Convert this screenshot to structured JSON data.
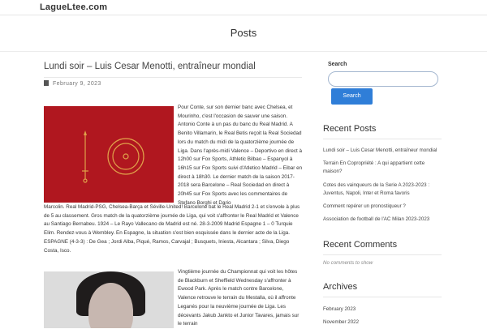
{
  "site": {
    "title": "LagueLtee.com"
  },
  "page": {
    "heading": "Posts"
  },
  "post1": {
    "title": "Lundi soir – Luis Cesar Menotti, entraîneur mondial",
    "date": "February 9, 2023",
    "text_wrap": "Pour Conte, sur son dernier banc avec Chelsea, et Mourinho, c'est l'occasion de sauver une saison. Antonio Conte à un pas du banc du Real Madrid. A Benito Villamarin, le Real Betis reçoit la Real Sociedad lors du match du midi de la quatorzième journée de Liga. Dans l'après-midi Valence – Deportivo en direct à 12h00 sur Fox Sports, Athletic Bilbao – Espanyol à 16h15 sur Fox Sports suivi d'Atletico Madrid – Eibar en direct à 18h30. Le dernier match de la saison 2017-2018 sera Barcelone – Real Sociedad en direct à 20h45 sur Fox Sports avec les commentaires de Stefano Borghi et Dario",
    "text_full": "Marcolin. Real Madrid-PSG, Chelsea-Barça et Séville-United! Barcelone bat le Real Madrid 2-1 et s'envole à plus de 5 au classement. Gros match de la quatorzième journée de Liga, qui voit s'affronter le Real Madrid et Valence au Santiago Bernabeu. 1924 – Le Rayo Vallecano de Madrid est né. 28-3-2009 Madrid Espagne 1 – 0 Turquie Elim. Rendez-vous à Wembley. En Espagne, la situation s'est bien esquissée dans le dernier acte de la Liga. ESPAGNE (4-3-3) : De Gea ; Jordi Alba, Piqué, Ramos, Carvajal ; Busquets, Iniesta, Alcantara ; Silva, Diego Costa, Isco."
  },
  "post2": {
    "text_wrap": "Vingtième journée du Championnat qui voit les hôtes de Blackburn et Sheffield Wednesday s'affronter à Ewood Park. Après le match contre Barcelone, Valence retrouve le terrain du Mestalla, où il affronte Leganés pour la neuvième journée de Liga. Les décevants Jakub Jankto et Junior Tavares, jamais sur le terrain"
  },
  "sidebar": {
    "search_label": "Search",
    "search_placeholder": "",
    "search_button": "Search",
    "recent_posts_heading": "Recent Posts",
    "recent_posts": [
      "Lundi soir – Luis Cesar Menotti, entraîneur mondial",
      "Terrain En Copropriété : A qui appartient cette maison?",
      "Cotes des vainqueurs de la Serie A 2023-2023 : Juventus, Napoli, Inter et Roma favoris",
      "Comment repérer un pronostiqueur ?",
      "Association de football de l'AC Milan 2023-2023"
    ],
    "recent_comments_heading": "Recent Comments",
    "no_comments": "No comments to show",
    "archives_heading": "Archives",
    "archives": [
      "February 2023",
      "November 2022"
    ]
  },
  "colors": {
    "accent": "#2f7ed8",
    "image_red": "#b0171f"
  },
  "icons": {
    "date": "calendar-icon"
  }
}
